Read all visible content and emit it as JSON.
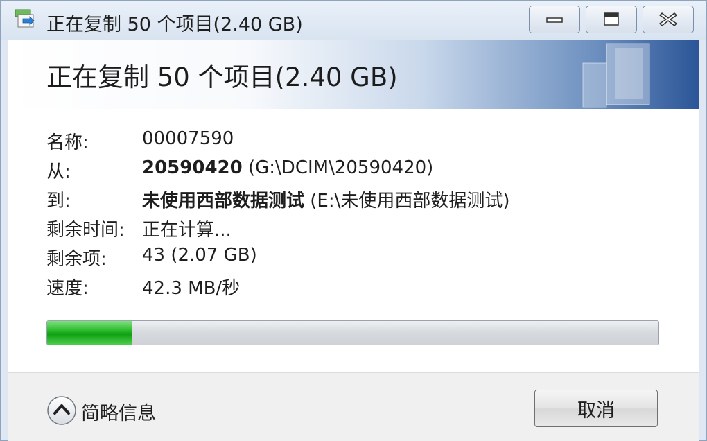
{
  "window": {
    "title": "正在复制 50 个项目(2.40 GB)"
  },
  "header": {
    "title": "正在复制 50 个项目(2.40 GB)"
  },
  "details": {
    "name_label": "名称:",
    "name_value": "00007590",
    "from_label": "从:",
    "from_bold": "20590420",
    "from_path": " (G:\\DCIM\\20590420)",
    "to_label": "到:",
    "to_bold": "未使用西部数据测试",
    "to_path": " (E:\\未使用西部数据测试)",
    "time_label": "剩余时间:",
    "time_value": "正在计算...",
    "items_label": "剩余项:",
    "items_value": "43 (2.07 GB)",
    "speed_label": "速度:",
    "speed_value": "42.3 MB/秒"
  },
  "progress": {
    "percent": 14
  },
  "footer": {
    "collapse_label": "简略信息",
    "cancel_label": "取消"
  },
  "icons": {
    "app": "copy-file-icon",
    "minimize": "minimize-icon",
    "maximize": "maximize-icon",
    "close": "close-icon",
    "collapse": "chevron-up-icon"
  },
  "colors": {
    "progress_fill": "#22b523",
    "header_gradient_end": "#2b5597"
  }
}
